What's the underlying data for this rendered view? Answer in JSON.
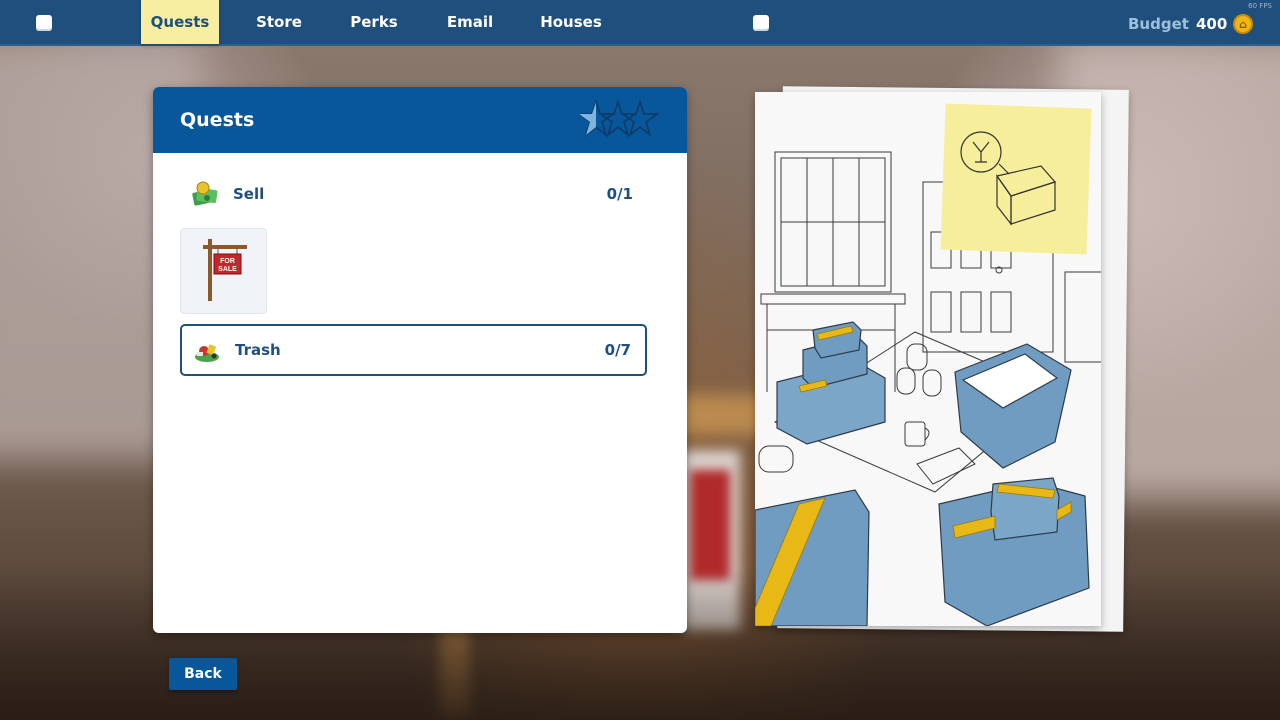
{
  "topbar": {
    "fps": "60 FPS",
    "nav": [
      {
        "label": "Quests",
        "active": true
      },
      {
        "label": "Store",
        "active": false
      },
      {
        "label": "Perks",
        "active": false
      },
      {
        "label": "Email",
        "active": false
      },
      {
        "label": "Houses",
        "active": false
      }
    ],
    "budget_label": "Budget",
    "budget_value": "400",
    "coin_icon": "house-coin-icon"
  },
  "panel": {
    "title": "Quests",
    "stars_filled_fraction": 0.33,
    "quests": [
      {
        "label": "Sell",
        "count": "0/1",
        "icon": "money-icon",
        "selected": false
      },
      {
        "label": "Trash",
        "count": "0/7",
        "icon": "trash-pile-icon",
        "selected": true
      }
    ],
    "item_tile_icon": "for-sale-sign-icon",
    "sign_text_line1": "FOR",
    "sign_text_line2": "SALE"
  },
  "back_label": "Back",
  "colors": {
    "topbar": "#1f4f7d",
    "panel_header": "#07579a",
    "active_tab": "#f7eea1",
    "text_blue": "#1f4f7d",
    "coin": "#f2b516",
    "box_blue": "#6f9cc0",
    "tape_yellow": "#e8b817"
  }
}
